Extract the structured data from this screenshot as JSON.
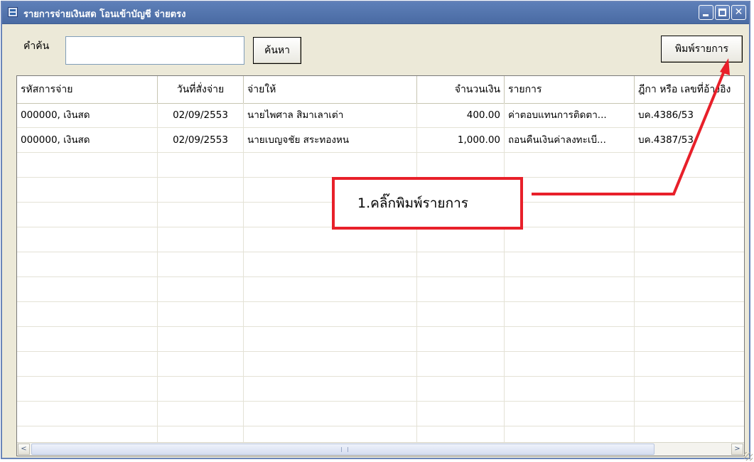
{
  "window": {
    "title": "รายการจ่ายเงินสด โอนเข้าบัญชี จ่ายตรง",
    "min_symbol": "",
    "max_symbol": "",
    "close_symbol": "✕"
  },
  "search": {
    "label": "คำค้น",
    "value": "",
    "button_label": "ค้นหา"
  },
  "toolbar": {
    "print_label": "พิมพ์รายการ"
  },
  "table": {
    "columns": [
      "รหัสการจ่าย",
      "วันที่สั่งจ่าย",
      "จ่ายให้",
      "จำนวนเงิน",
      "รายการ",
      "ฎีกา หรือ เลขที่อ้างอิง"
    ],
    "rows": [
      [
        "000000, เงินสด",
        "02/09/2553",
        "นายไพศาล สิมาเลาเต่า",
        "400.00",
        "ค่าตอบแทนการติดตา...",
        "บค.4386/53"
      ],
      [
        "000000, เงินสด",
        "02/09/2553",
        "นายเบญจชัย สระทองหน",
        "1,000.00",
        "ถอนคืนเงินค่าลงทะเบี...",
        "บค.4387/53"
      ]
    ]
  },
  "scrollbar": {
    "left_arrow": "<",
    "right_arrow": ">"
  },
  "annotation": {
    "callout_text": "1.คลิ๊กพิมพ์รายการ",
    "color": "#e8202a"
  }
}
